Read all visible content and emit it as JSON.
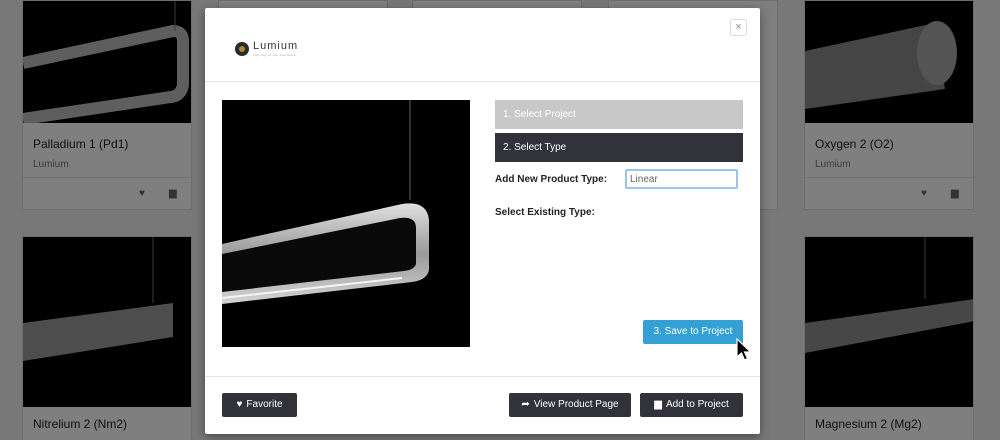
{
  "background_cards": [
    {
      "title": "Palladium 1 (Pd1)",
      "brand": "Lumium"
    },
    {
      "title": "Oxygen 2 (O2)",
      "brand": "Lumium"
    },
    {
      "title": "Nitrelium 2 (Nm2)"
    },
    {
      "title": "Magnesium 2 (Mg2)"
    }
  ],
  "modal": {
    "logo_text": "Lumium",
    "logo_tagline": "lighting of the elements",
    "close_label": "×",
    "steps": [
      "1. Select Project",
      "2. Select Type"
    ],
    "add_type_label": "Add New Product Type:",
    "type_input_value": "Linear",
    "existing_type_label": "Select Existing Type:",
    "save_label": "3. Save to Project",
    "footer": {
      "favorite_label": "Favorite",
      "view_label": "View Product Page",
      "add_label": "Add to Project"
    }
  },
  "icons": {
    "favorite": "heart-icon",
    "view": "share-arrow-icon",
    "add": "folder-icon"
  },
  "colors": {
    "dark_button": "#32333a",
    "accent": "#35a0d4",
    "step_inactive": "#c8c8c8"
  }
}
